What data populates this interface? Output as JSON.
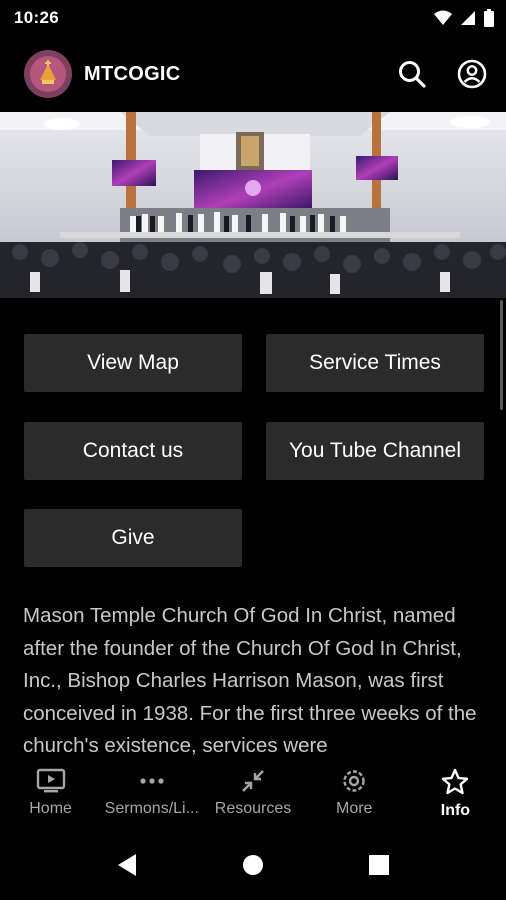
{
  "status_bar": {
    "time": "10:26"
  },
  "app_bar": {
    "title": "MTCOGIC"
  },
  "buttons": {
    "view_map": "View Map",
    "service_times": "Service Times",
    "contact_us": "Contact us",
    "youtube": "You Tube Channel",
    "give": "Give"
  },
  "description": "Mason Temple Church Of God In Christ, named after the founder of the Church Of God In Christ, Inc., Bishop Charles Harrison Mason, was first conceived in 1938. For the first three weeks of the church's existence, services were",
  "bottom_nav": {
    "items": [
      {
        "label": "Home",
        "icon": "tv-play-icon"
      },
      {
        "label": "Sermons/Li...",
        "icon": "more-horiz-icon"
      },
      {
        "label": "Resources",
        "icon": "collapse-arrows-icon"
      },
      {
        "label": "More",
        "icon": "gear-icon"
      },
      {
        "label": "Info",
        "icon": "star-icon"
      }
    ],
    "active_index": 4
  },
  "colors": {
    "background": "#000000",
    "button": "#2b2b2b",
    "text_muted": "#c8c8c8"
  }
}
